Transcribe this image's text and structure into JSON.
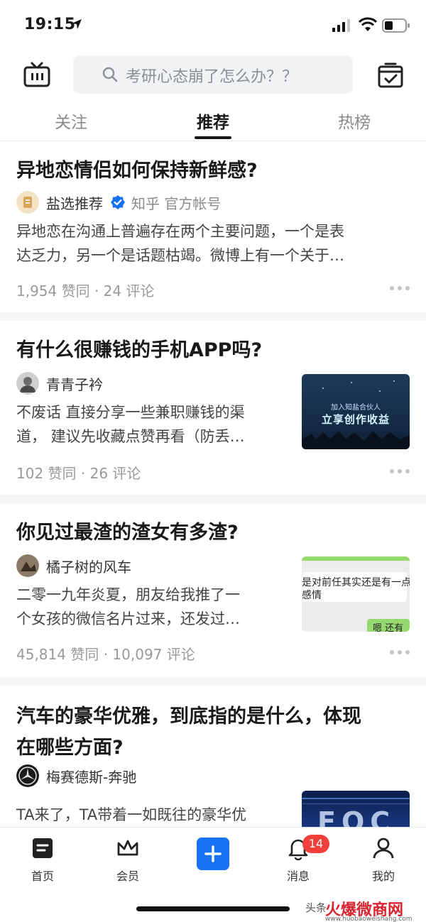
{
  "status_bar": {
    "time": "19:15"
  },
  "search": {
    "placeholder": "考研心态崩了怎么办？？"
  },
  "tabs": [
    {
      "label": "关注"
    },
    {
      "label": "推荐",
      "active": true
    },
    {
      "label": "热榜"
    }
  ],
  "feed": [
    {
      "title": "异地恋情侣如何保持新鲜感?",
      "author": "盐选推荐",
      "author_tag": "知乎 官方帐号",
      "verified": true,
      "excerpt_lines": [
        "异地恋在沟通上普遍存在两个主要问题，一个是表",
        "达乏力，另一个是话题枯竭。微博上有一个关于…"
      ],
      "stats": "1,954 赞同 · 24 评论"
    },
    {
      "title": "有什么很赚钱的手机APP吗?",
      "author": "青青子衿",
      "excerpt_lines": [
        "不废话 直接分享一些兼职赚钱的渠",
        "道， 建议先收藏点赞再看（防丢…"
      ],
      "stats": "102 赞同 · 26 评论",
      "thumb_small": "加入知盐合伙人",
      "thumb_big": "立享创作收益"
    },
    {
      "title": "你见过最渣的渣女有多渣?",
      "author": "橘子树的风车",
      "excerpt_lines": [
        "二零一九年炎夏，朋友给我推了一",
        "个女孩的微信名片过来，还发过…"
      ],
      "stats": "45,814 赞同 · 10,097 评论",
      "thumb_line1": "是对前任其实还是有一点",
      "thumb_line2": "感情",
      "thumb_bubble": "嗯 还有"
    },
    {
      "title_lines": [
        "汽车的豪华优雅，到底指的是什么，体现",
        "在哪些方面?"
      ],
      "author": "梅赛德斯-奔驰",
      "excerpt_lines": [
        "TA来了，TA带着一如既往的豪华优"
      ],
      "thumb_text": "EQC"
    }
  ],
  "bottom_nav": [
    {
      "label": "首页",
      "icon": "home-icon"
    },
    {
      "label": "会员",
      "icon": "crown-icon"
    },
    {
      "label": "",
      "icon": "plus-icon"
    },
    {
      "label": "消息",
      "icon": "bell-icon",
      "badge": "14"
    },
    {
      "label": "我的",
      "icon": "person-icon"
    }
  ],
  "watermark": {
    "prefix": "头条",
    "brand": "火爆微商网",
    "url": "www.huobaoweishang.com"
  },
  "colors": {
    "accent": "#1772f6",
    "badge": "#f1403c",
    "verified": "#1772f6"
  }
}
